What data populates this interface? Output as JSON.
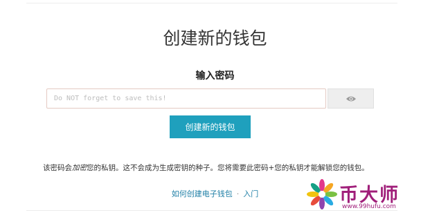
{
  "page": {
    "title": "创建新的钱包"
  },
  "form": {
    "password_label": "输入密码",
    "password_placeholder": "Do NOT forget to save this!",
    "create_button_label": "创建新的钱包",
    "toggle_visibility_icon": "eye-icon"
  },
  "info": {
    "prefix": "该密码会",
    "emphasis": "加密",
    "suffix": "您的私钥。这不会成为生成密钥的种子。您将需要此密码+您的私钥才能解锁您的钱包。"
  },
  "links": {
    "guide_label": "如何创建电子钱包",
    "separator": "·",
    "intro_label": "入门"
  },
  "watermark": {
    "name": "币大师",
    "url": "www.99hufu.com",
    "icon": "flower-logo-icon"
  },
  "colors": {
    "accent": "#1fa0bd",
    "link": "#1f7fa6",
    "watermark": "#a01f7a"
  }
}
